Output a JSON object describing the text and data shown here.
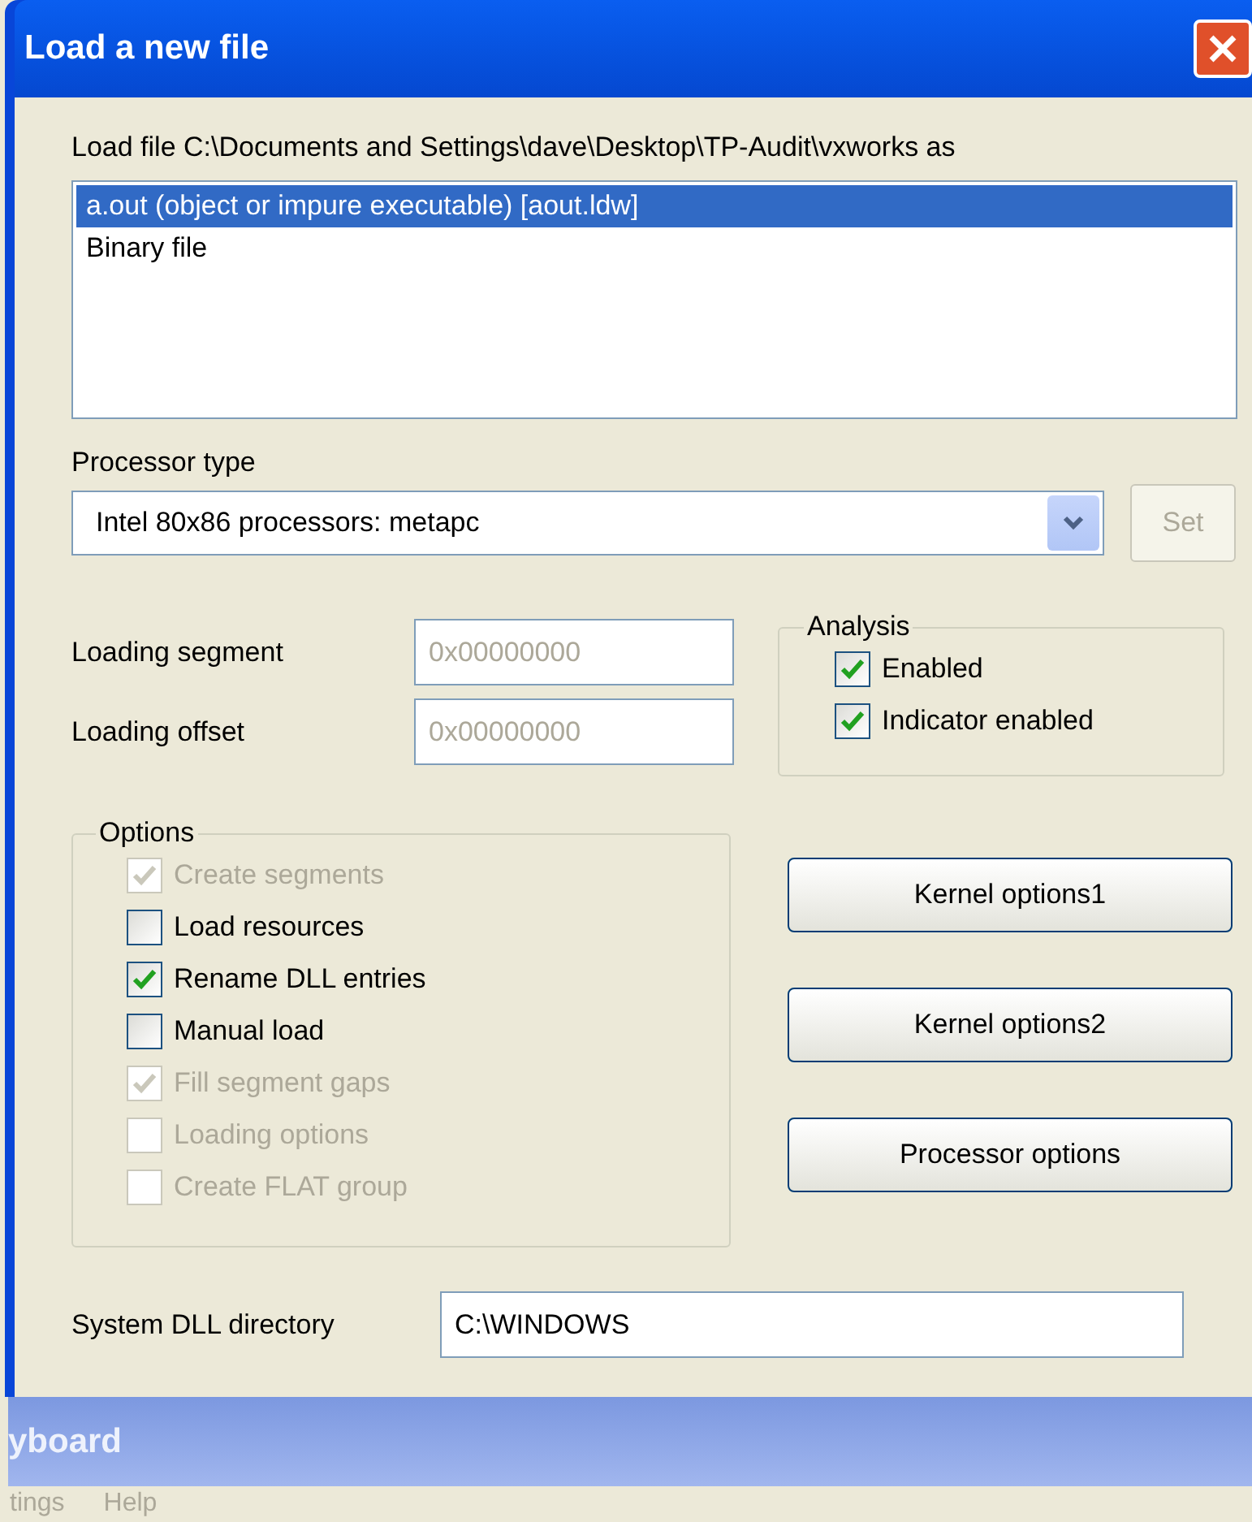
{
  "dialog": {
    "title": "Load a new file",
    "file_label": "Load file C:\\Documents and Settings\\dave\\Desktop\\TP-Audit\\vxworks as",
    "file_types": [
      {
        "label": "a.out (object or impure executable) [aout.ldw]",
        "selected": true
      },
      {
        "label": "Binary file",
        "selected": false
      }
    ],
    "processor": {
      "label": "Processor type",
      "value": "Intel 80x86 processors: metapc",
      "set_button": {
        "label": "Set",
        "disabled": true
      }
    },
    "loading_fields": [
      {
        "label": "Loading segment",
        "value": "0x00000000",
        "disabled": true
      },
      {
        "label": "Loading offset",
        "value": "0x00000000",
        "disabled": true
      }
    ],
    "analysis": {
      "title": "Analysis",
      "items": [
        {
          "label": "Enabled",
          "checked": true,
          "disabled": false
        },
        {
          "label": "Indicator enabled",
          "checked": true,
          "disabled": false
        }
      ]
    },
    "options": {
      "title": "Options",
      "items": [
        {
          "label": "Create segments",
          "checked": true,
          "disabled": true
        },
        {
          "label": "Load resources",
          "checked": false,
          "disabled": false
        },
        {
          "label": "Rename DLL entries",
          "checked": true,
          "disabled": false
        },
        {
          "label": "Manual load",
          "checked": false,
          "disabled": false
        },
        {
          "label": "Fill segment gaps",
          "checked": true,
          "disabled": true
        },
        {
          "label": "Loading options",
          "checked": false,
          "disabled": true
        },
        {
          "label": "Create FLAT group",
          "checked": false,
          "disabled": true
        }
      ]
    },
    "buttons": [
      "Kernel options1",
      "Kernel options2",
      "Processor options"
    ],
    "dll_directory": {
      "label": "System DLL directory",
      "value": "C:\\WINDOWS"
    }
  },
  "background_window": {
    "title": "yboard",
    "menu": [
      "tings",
      "Help"
    ]
  }
}
